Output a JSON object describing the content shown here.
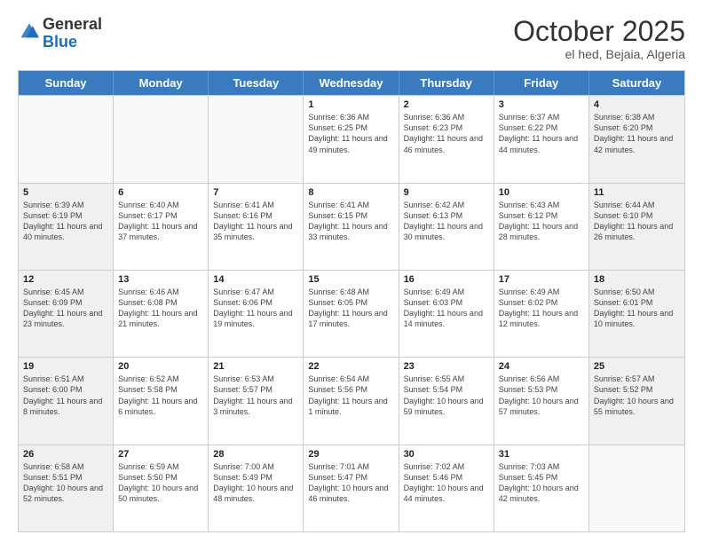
{
  "logo": {
    "general": "General",
    "blue": "Blue"
  },
  "header": {
    "title": "October 2025",
    "subtitle": "el hed, Bejaia, Algeria"
  },
  "weekdays": [
    "Sunday",
    "Monday",
    "Tuesday",
    "Wednesday",
    "Thursday",
    "Friday",
    "Saturday"
  ],
  "weeks": [
    [
      {
        "day": "",
        "info": "",
        "empty": true
      },
      {
        "day": "",
        "info": "",
        "empty": true
      },
      {
        "day": "",
        "info": "",
        "empty": true
      },
      {
        "day": "1",
        "info": "Sunrise: 6:36 AM\nSunset: 6:25 PM\nDaylight: 11 hours and 49 minutes."
      },
      {
        "day": "2",
        "info": "Sunrise: 6:36 AM\nSunset: 6:23 PM\nDaylight: 11 hours and 46 minutes."
      },
      {
        "day": "3",
        "info": "Sunrise: 6:37 AM\nSunset: 6:22 PM\nDaylight: 11 hours and 44 minutes."
      },
      {
        "day": "4",
        "info": "Sunrise: 6:38 AM\nSunset: 6:20 PM\nDaylight: 11 hours and 42 minutes.",
        "shaded": true
      }
    ],
    [
      {
        "day": "5",
        "info": "Sunrise: 6:39 AM\nSunset: 6:19 PM\nDaylight: 11 hours and 40 minutes.",
        "shaded": true
      },
      {
        "day": "6",
        "info": "Sunrise: 6:40 AM\nSunset: 6:17 PM\nDaylight: 11 hours and 37 minutes."
      },
      {
        "day": "7",
        "info": "Sunrise: 6:41 AM\nSunset: 6:16 PM\nDaylight: 11 hours and 35 minutes."
      },
      {
        "day": "8",
        "info": "Sunrise: 6:41 AM\nSunset: 6:15 PM\nDaylight: 11 hours and 33 minutes."
      },
      {
        "day": "9",
        "info": "Sunrise: 6:42 AM\nSunset: 6:13 PM\nDaylight: 11 hours and 30 minutes."
      },
      {
        "day": "10",
        "info": "Sunrise: 6:43 AM\nSunset: 6:12 PM\nDaylight: 11 hours and 28 minutes."
      },
      {
        "day": "11",
        "info": "Sunrise: 6:44 AM\nSunset: 6:10 PM\nDaylight: 11 hours and 26 minutes.",
        "shaded": true
      }
    ],
    [
      {
        "day": "12",
        "info": "Sunrise: 6:45 AM\nSunset: 6:09 PM\nDaylight: 11 hours and 23 minutes.",
        "shaded": true
      },
      {
        "day": "13",
        "info": "Sunrise: 6:46 AM\nSunset: 6:08 PM\nDaylight: 11 hours and 21 minutes."
      },
      {
        "day": "14",
        "info": "Sunrise: 6:47 AM\nSunset: 6:06 PM\nDaylight: 11 hours and 19 minutes."
      },
      {
        "day": "15",
        "info": "Sunrise: 6:48 AM\nSunset: 6:05 PM\nDaylight: 11 hours and 17 minutes."
      },
      {
        "day": "16",
        "info": "Sunrise: 6:49 AM\nSunset: 6:03 PM\nDaylight: 11 hours and 14 minutes."
      },
      {
        "day": "17",
        "info": "Sunrise: 6:49 AM\nSunset: 6:02 PM\nDaylight: 11 hours and 12 minutes."
      },
      {
        "day": "18",
        "info": "Sunrise: 6:50 AM\nSunset: 6:01 PM\nDaylight: 11 hours and 10 minutes.",
        "shaded": true
      }
    ],
    [
      {
        "day": "19",
        "info": "Sunrise: 6:51 AM\nSunset: 6:00 PM\nDaylight: 11 hours and 8 minutes.",
        "shaded": true
      },
      {
        "day": "20",
        "info": "Sunrise: 6:52 AM\nSunset: 5:58 PM\nDaylight: 11 hours and 6 minutes."
      },
      {
        "day": "21",
        "info": "Sunrise: 6:53 AM\nSunset: 5:57 PM\nDaylight: 11 hours and 3 minutes."
      },
      {
        "day": "22",
        "info": "Sunrise: 6:54 AM\nSunset: 5:56 PM\nDaylight: 11 hours and 1 minute."
      },
      {
        "day": "23",
        "info": "Sunrise: 6:55 AM\nSunset: 5:54 PM\nDaylight: 10 hours and 59 minutes."
      },
      {
        "day": "24",
        "info": "Sunrise: 6:56 AM\nSunset: 5:53 PM\nDaylight: 10 hours and 57 minutes."
      },
      {
        "day": "25",
        "info": "Sunrise: 6:57 AM\nSunset: 5:52 PM\nDaylight: 10 hours and 55 minutes.",
        "shaded": true
      }
    ],
    [
      {
        "day": "26",
        "info": "Sunrise: 6:58 AM\nSunset: 5:51 PM\nDaylight: 10 hours and 52 minutes.",
        "shaded": true
      },
      {
        "day": "27",
        "info": "Sunrise: 6:59 AM\nSunset: 5:50 PM\nDaylight: 10 hours and 50 minutes."
      },
      {
        "day": "28",
        "info": "Sunrise: 7:00 AM\nSunset: 5:49 PM\nDaylight: 10 hours and 48 minutes."
      },
      {
        "day": "29",
        "info": "Sunrise: 7:01 AM\nSunset: 5:47 PM\nDaylight: 10 hours and 46 minutes."
      },
      {
        "day": "30",
        "info": "Sunrise: 7:02 AM\nSunset: 5:46 PM\nDaylight: 10 hours and 44 minutes."
      },
      {
        "day": "31",
        "info": "Sunrise: 7:03 AM\nSunset: 5:45 PM\nDaylight: 10 hours and 42 minutes."
      },
      {
        "day": "",
        "info": "",
        "empty": true
      }
    ]
  ]
}
